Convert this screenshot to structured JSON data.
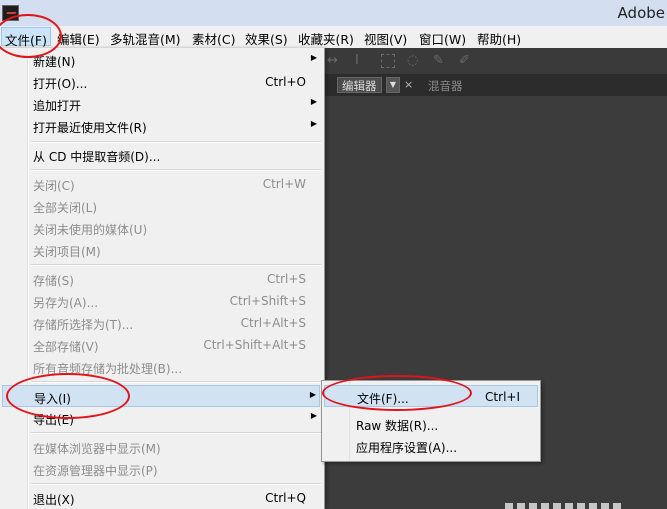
{
  "window": {
    "title": "Adobe"
  },
  "menubar": [
    {
      "label": "文件(F)"
    },
    {
      "label": "编辑(E)"
    },
    {
      "label": "多轨混音(M)"
    },
    {
      "label": "素材(C)"
    },
    {
      "label": "效果(S)"
    },
    {
      "label": "收藏夹(R)"
    },
    {
      "label": "视图(V)"
    },
    {
      "label": "窗口(W)"
    },
    {
      "label": "帮助(H)"
    }
  ],
  "panels": {
    "editor_tab": "编辑器",
    "close_glyph": "×",
    "mixer_tab": "混音器"
  },
  "file_menu": {
    "items": [
      {
        "label": "新建(N)",
        "shortcut": "",
        "submenu": true,
        "enabled": true
      },
      {
        "label": "打开(O)...",
        "shortcut": "Ctrl+O",
        "submenu": false,
        "enabled": true
      },
      {
        "label": "追加打开",
        "shortcut": "",
        "submenu": true,
        "enabled": true
      },
      {
        "label": "打开最近使用文件(R)",
        "shortcut": "",
        "submenu": true,
        "enabled": true
      },
      {
        "label": "从 CD 中提取音频(D)...",
        "shortcut": "",
        "submenu": false,
        "enabled": true
      },
      {
        "label": "关闭(C)",
        "shortcut": "Ctrl+W",
        "submenu": false,
        "enabled": false
      },
      {
        "label": "全部关闭(L)",
        "shortcut": "",
        "submenu": false,
        "enabled": false
      },
      {
        "label": "关闭未使用的媒体(U)",
        "shortcut": "",
        "submenu": false,
        "enabled": false
      },
      {
        "label": "关闭项目(M)",
        "shortcut": "",
        "submenu": false,
        "enabled": false
      },
      {
        "label": "存储(S)",
        "shortcut": "Ctrl+S",
        "submenu": false,
        "enabled": false
      },
      {
        "label": "另存为(A)...",
        "shortcut": "Ctrl+Shift+S",
        "submenu": false,
        "enabled": false
      },
      {
        "label": "存储所选择为(T)...",
        "shortcut": "Ctrl+Alt+S",
        "submenu": false,
        "enabled": false
      },
      {
        "label": "全部存储(V)",
        "shortcut": "Ctrl+Shift+Alt+S",
        "submenu": false,
        "enabled": false
      },
      {
        "label": "所有音频存储为批处理(B)...",
        "shortcut": "",
        "submenu": false,
        "enabled": false
      },
      {
        "label": "导入(I)",
        "shortcut": "",
        "submenu": true,
        "enabled": true,
        "highlighted": true
      },
      {
        "label": "导出(E)",
        "shortcut": "",
        "submenu": true,
        "enabled": true
      },
      {
        "label": "在媒体浏览器中显示(M)",
        "shortcut": "",
        "submenu": false,
        "enabled": false
      },
      {
        "label": "在资源管理器中显示(P)",
        "shortcut": "",
        "submenu": false,
        "enabled": false
      },
      {
        "label": "退出(X)",
        "shortcut": "Ctrl+Q",
        "submenu": false,
        "enabled": true
      }
    ]
  },
  "import_submenu": {
    "items": [
      {
        "label": "文件(F)...",
        "shortcut": "Ctrl+I",
        "highlighted": true
      },
      {
        "label": "Raw 数据(R)...",
        "shortcut": ""
      },
      {
        "label": "应用程序设置(A)...",
        "shortcut": ""
      }
    ]
  },
  "annotation_color": "#e0141a"
}
